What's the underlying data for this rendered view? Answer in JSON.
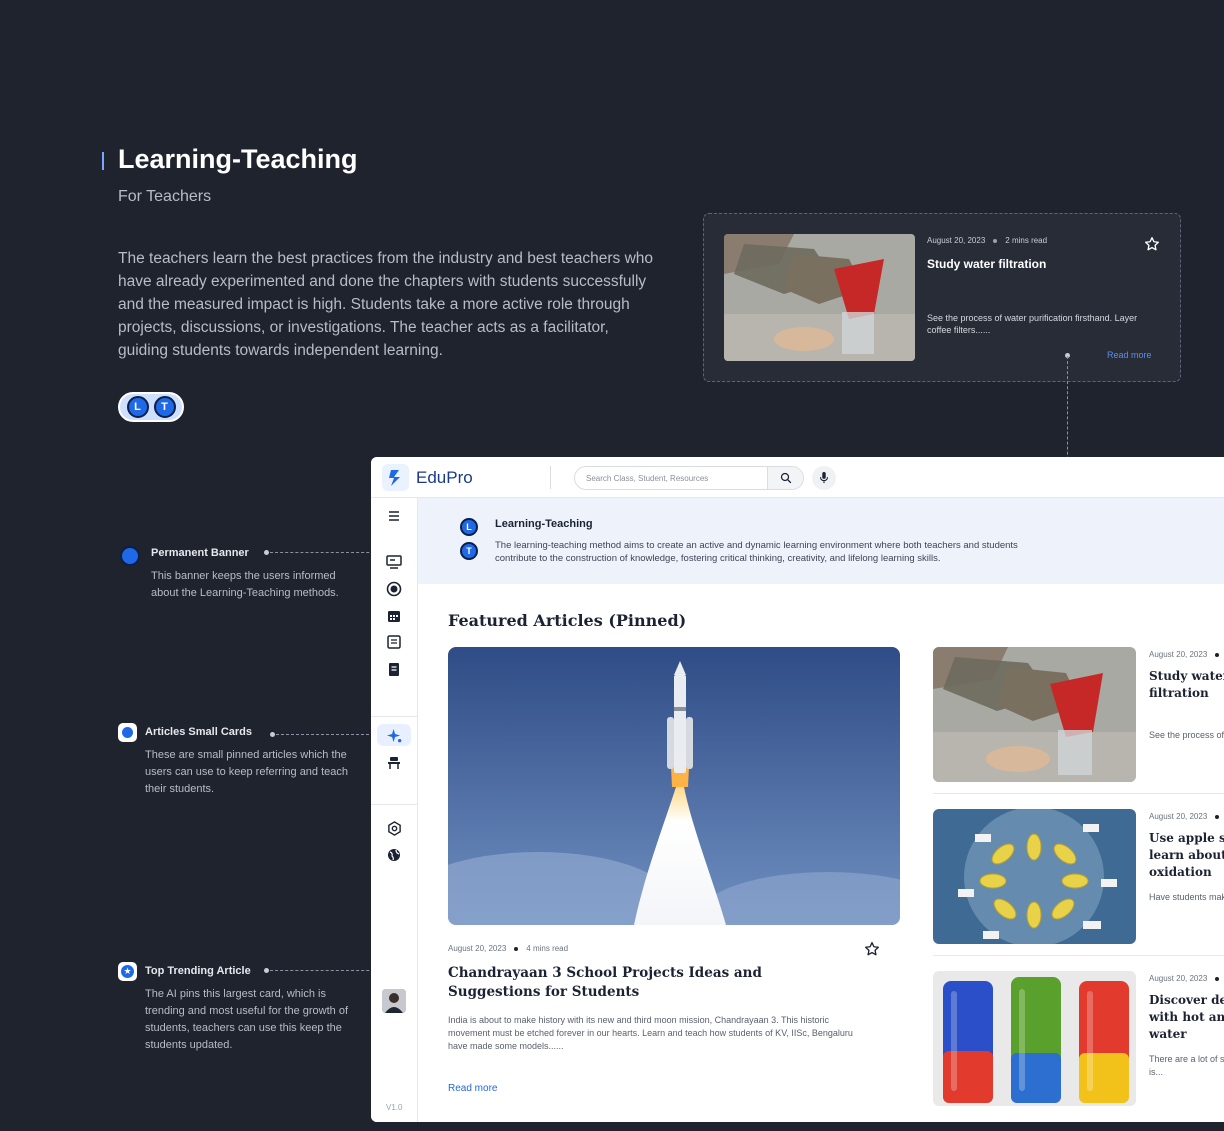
{
  "intro": {
    "title": "Learning-Teaching",
    "subtitle": "For Teachers",
    "description": "The teachers learn the best practices from the industry and best teachers who have already experimented and done the chapters with students successfully and the measured impact is high. Students take a more active role through projects, discussions, or investigations. The teacher acts as a facilitator, guiding students towards independent learning.",
    "toggle": {
      "left": "L",
      "right": "T"
    }
  },
  "floating_card": {
    "date": "August 20, 2023",
    "read_time": "2 mins read",
    "title": "Study water filtration",
    "excerpt": "See the process of water purification firsthand. Layer coffee filters......",
    "read_more": "Read more"
  },
  "annotations": [
    {
      "title": "Permanent Banner",
      "text": "This banner keeps the users informed about the Learning-Teaching methods."
    },
    {
      "title": "Articles Small Cards",
      "text": "These are small pinned articles which the users can use to keep referring and teach their students."
    },
    {
      "title": "Top Trending Article",
      "text": "The AI pins this largest card, which is trending and most useful for the growth of students, teachers can use this keep the students updated."
    }
  ],
  "app": {
    "brand": "EduPro",
    "search_placeholder": "Search Class, Student, Resources",
    "version": "V1.0",
    "banner": {
      "icons": [
        "L",
        "T"
      ],
      "title": "Learning-Teaching",
      "text": "The learning-teaching method aims to create an active and dynamic learning environment where both teachers and students contribute to the construction of knowledge, fostering critical thinking, creativity, and lifelong learning skills."
    },
    "section_title": "Featured Articles (Pinned)",
    "hero": {
      "date": "August 20, 2023",
      "read_time": "4 mins read",
      "title": "Chandrayaan 3 School Projects Ideas and Suggestions for Students",
      "excerpt": "India is about to make history with its new and third moon mission, Chandrayaan 3. This historic movement must be etched forever in our hearts. Learn and teach how students of KV, IISc, Bengaluru have made some models......",
      "read_more": "Read more"
    },
    "small_cards": [
      {
        "date": "August 20, 2023",
        "title": "Study water filtration",
        "excerpt": "See the process of water purification firsthand. Layer coffee filters......"
      },
      {
        "date": "August 20, 2023",
        "title": "Use apple slices to learn about oxidation",
        "excerpt": "Have students make observations about what will happen to apple slices..."
      },
      {
        "date": "August 20, 2023",
        "title": "Discover density with hot and cold water",
        "excerpt": "There are a lot of science experiments you can do with density. This one is..."
      }
    ]
  },
  "colors": {
    "background": "#1f232d",
    "accent": "#1f68e6",
    "banner": "#eef2fb"
  }
}
